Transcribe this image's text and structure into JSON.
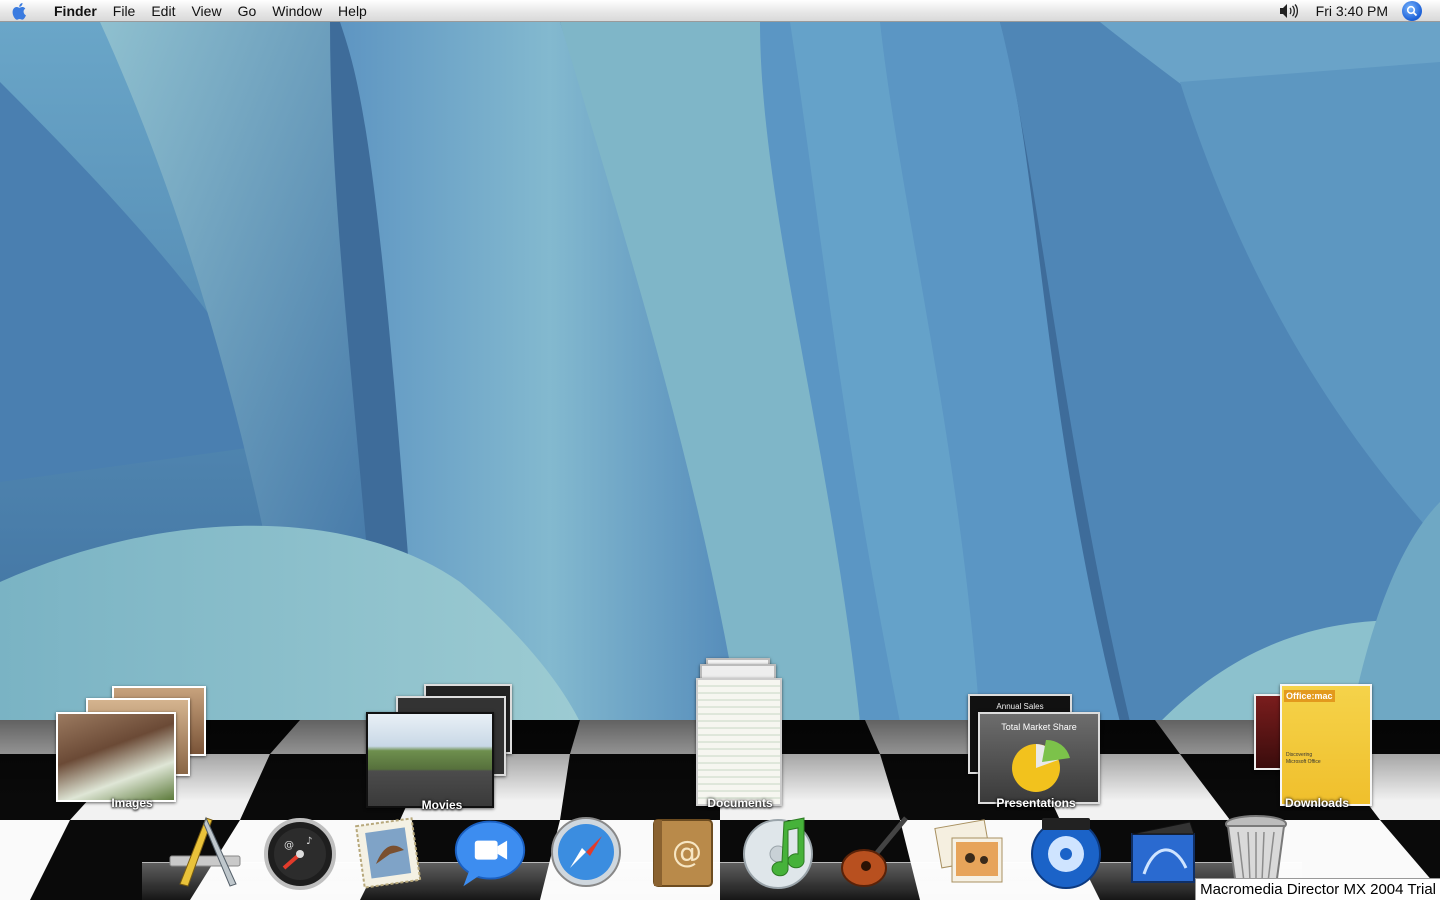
{
  "menubar": {
    "app_name": "Finder",
    "menus": [
      "File",
      "Edit",
      "View",
      "Go",
      "Window",
      "Help"
    ],
    "clock": "Fri 3:40 PM"
  },
  "stacks": [
    {
      "label": "Images"
    },
    {
      "label": "Movies"
    },
    {
      "label": "Documents"
    },
    {
      "label": "Presentations",
      "card_back_text": "Annual Sales",
      "card_front_text": "Total Market Share"
    },
    {
      "label": "Downloads",
      "card_front_text": "Office:mac",
      "card_sub_text": "Discovering Microsoft Office"
    }
  ],
  "dock": {
    "items": [
      "applications",
      "dashboard",
      "mail",
      "ichat",
      "safari",
      "address-book",
      "itunes",
      "garageband",
      "iphoto",
      "dvd-player",
      "imovie",
      "trash"
    ]
  },
  "trial_banner": "Macromedia Director MX 2004 Trial",
  "colors": {
    "accent": "#1a5fd6",
    "wallpaper": "#4f86ad"
  }
}
